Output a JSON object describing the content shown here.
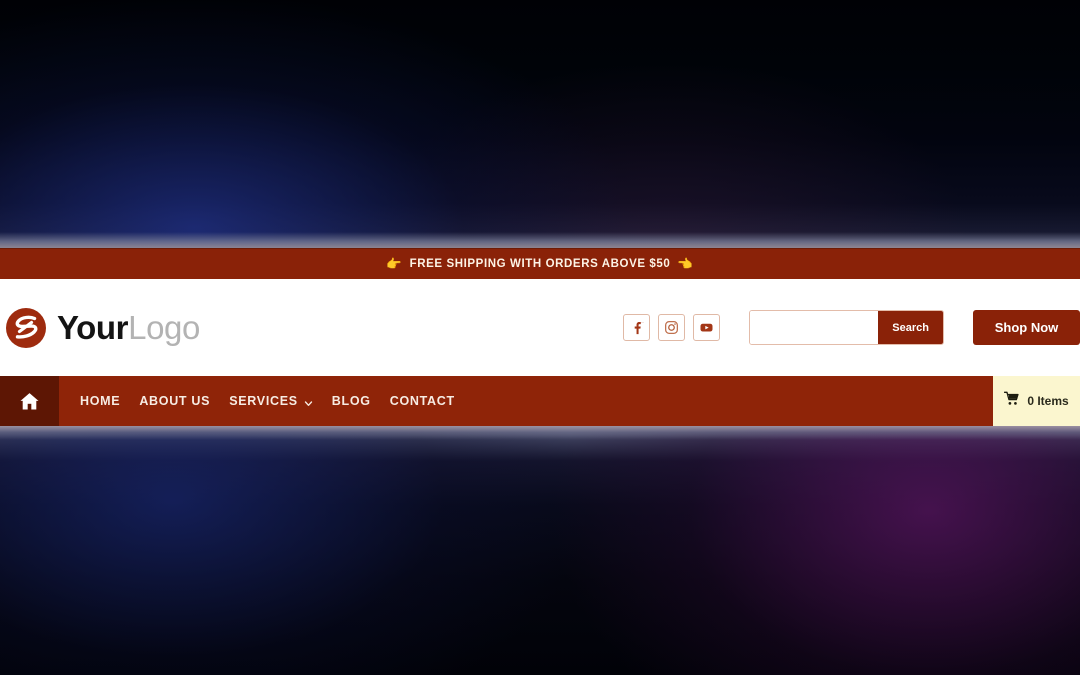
{
  "promo": {
    "icon_left": "pointing-right-hand",
    "icon_right": "pointing-left-hand",
    "emoji_left": "👉",
    "emoji_right": "👈",
    "text": "FREE SHIPPING WITH ORDERS ABOVE $50",
    "background_color": "#8a2208",
    "text_color": "#fdf3e6"
  },
  "header": {
    "brand": {
      "mark_icon": "swirl-circle-logo-mark",
      "mark_color": "#9e2b0e",
      "name_primary": "Your",
      "name_secondary": "Logo",
      "primary_color": "#141414",
      "secondary_color": "#b3b3b3"
    },
    "social": [
      {
        "name": "facebook",
        "icon": "facebook-icon",
        "glyph": "f"
      },
      {
        "name": "instagram",
        "icon": "instagram-icon",
        "glyph": ""
      },
      {
        "name": "youtube",
        "icon": "youtube-icon",
        "glyph": ""
      }
    ],
    "search": {
      "value": "",
      "placeholder": "",
      "button_label": "Search",
      "button_color": "#8a2208"
    },
    "shop_now": {
      "label": "Shop Now",
      "background_color": "#8a2208"
    },
    "background_color": "#ffffff"
  },
  "nav": {
    "home_icon": "home-icon",
    "home_box_color": "#5d1604",
    "background_color": "#8f2408",
    "items": [
      {
        "label": "HOME",
        "has_dropdown": false
      },
      {
        "label": "ABOUT US",
        "has_dropdown": false
      },
      {
        "label": "SERVICES",
        "has_dropdown": true
      },
      {
        "label": "BLOG",
        "has_dropdown": false
      },
      {
        "label": "CONTACT",
        "has_dropdown": false
      }
    ],
    "cart": {
      "icon": "shopping-cart-icon",
      "label": "0 Items",
      "background_color": "#fbf6cf",
      "text_color": "#2a2a1c"
    }
  },
  "background": {
    "top_colors": [
      "#020830",
      "#000106",
      "#000000"
    ],
    "bottom_colors": [
      "#030b33",
      "#2a0a3a",
      "#3a0f4a"
    ]
  }
}
